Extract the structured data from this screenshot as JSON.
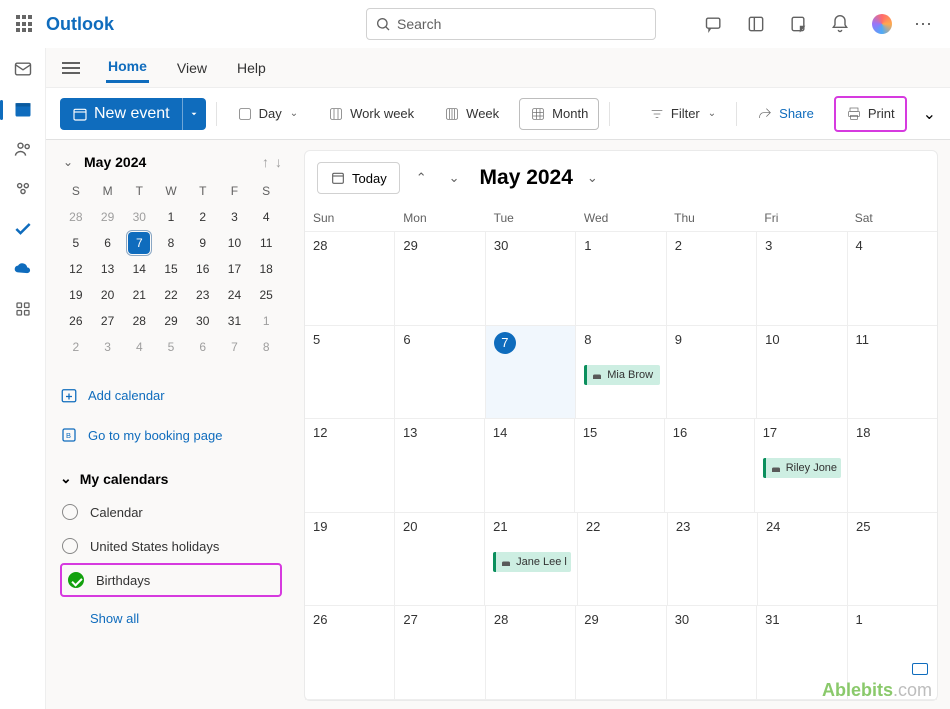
{
  "brand": "Outlook",
  "search_placeholder": "Search",
  "tabs": {
    "home": "Home",
    "view": "View",
    "help": "Help"
  },
  "toolbar": {
    "new_event": "New event",
    "day": "Day",
    "workweek": "Work week",
    "week": "Week",
    "month": "Month",
    "filter": "Filter",
    "share": "Share",
    "print": "Print"
  },
  "mini": {
    "title": "May 2024",
    "dow": [
      "S",
      "M",
      "T",
      "W",
      "T",
      "F",
      "S"
    ],
    "rows": [
      [
        {
          "d": "28",
          "o": true
        },
        {
          "d": "29",
          "o": true
        },
        {
          "d": "30",
          "o": true
        },
        {
          "d": "1"
        },
        {
          "d": "2"
        },
        {
          "d": "3"
        },
        {
          "d": "4"
        }
      ],
      [
        {
          "d": "5"
        },
        {
          "d": "6"
        },
        {
          "d": "7",
          "t": true
        },
        {
          "d": "8"
        },
        {
          "d": "9"
        },
        {
          "d": "10"
        },
        {
          "d": "11"
        }
      ],
      [
        {
          "d": "12"
        },
        {
          "d": "13"
        },
        {
          "d": "14"
        },
        {
          "d": "15"
        },
        {
          "d": "16"
        },
        {
          "d": "17"
        },
        {
          "d": "18"
        }
      ],
      [
        {
          "d": "19"
        },
        {
          "d": "20"
        },
        {
          "d": "21"
        },
        {
          "d": "22"
        },
        {
          "d": "23"
        },
        {
          "d": "24"
        },
        {
          "d": "25"
        }
      ],
      [
        {
          "d": "26"
        },
        {
          "d": "27"
        },
        {
          "d": "28"
        },
        {
          "d": "29"
        },
        {
          "d": "30"
        },
        {
          "d": "31"
        },
        {
          "d": "1",
          "o": true
        }
      ],
      [
        {
          "d": "2",
          "o": true
        },
        {
          "d": "3",
          "o": true
        },
        {
          "d": "4",
          "o": true
        },
        {
          "d": "5",
          "o": true
        },
        {
          "d": "6",
          "o": true
        },
        {
          "d": "7",
          "o": true
        },
        {
          "d": "8",
          "o": true
        }
      ]
    ]
  },
  "side": {
    "add_calendar": "Add calendar",
    "booking": "Go to my booking page",
    "section": "My calendars",
    "items": [
      "Calendar",
      "United States holidays",
      "Birthdays"
    ],
    "showall": "Show all"
  },
  "cal": {
    "today": "Today",
    "month_label": "May 2024",
    "dow": [
      "Sun",
      "Mon",
      "Tue",
      "Wed",
      "Thu",
      "Fri",
      "Sat"
    ],
    "weeks": [
      [
        {
          "n": "28"
        },
        {
          "n": "29"
        },
        {
          "n": "30"
        },
        {
          "n": "1"
        },
        {
          "n": "2"
        },
        {
          "n": "3"
        },
        {
          "n": "4"
        }
      ],
      [
        {
          "n": "5"
        },
        {
          "n": "6"
        },
        {
          "n": "7",
          "today": true
        },
        {
          "n": "8",
          "ev": "Mia Brow"
        },
        {
          "n": "9"
        },
        {
          "n": "10"
        },
        {
          "n": "11"
        }
      ],
      [
        {
          "n": "12"
        },
        {
          "n": "13"
        },
        {
          "n": "14"
        },
        {
          "n": "15"
        },
        {
          "n": "16"
        },
        {
          "n": "17",
          "ev": "Riley Jone"
        },
        {
          "n": "18"
        }
      ],
      [
        {
          "n": "19"
        },
        {
          "n": "20"
        },
        {
          "n": "21",
          "ev": "Jane Lee l"
        },
        {
          "n": "22"
        },
        {
          "n": "23"
        },
        {
          "n": "24"
        },
        {
          "n": "25"
        }
      ],
      [
        {
          "n": "26"
        },
        {
          "n": "27"
        },
        {
          "n": "28"
        },
        {
          "n": "29"
        },
        {
          "n": "30"
        },
        {
          "n": "31"
        },
        {
          "n": "1"
        }
      ]
    ]
  },
  "watermark": {
    "a": "Ablebits",
    "b": ".com"
  }
}
